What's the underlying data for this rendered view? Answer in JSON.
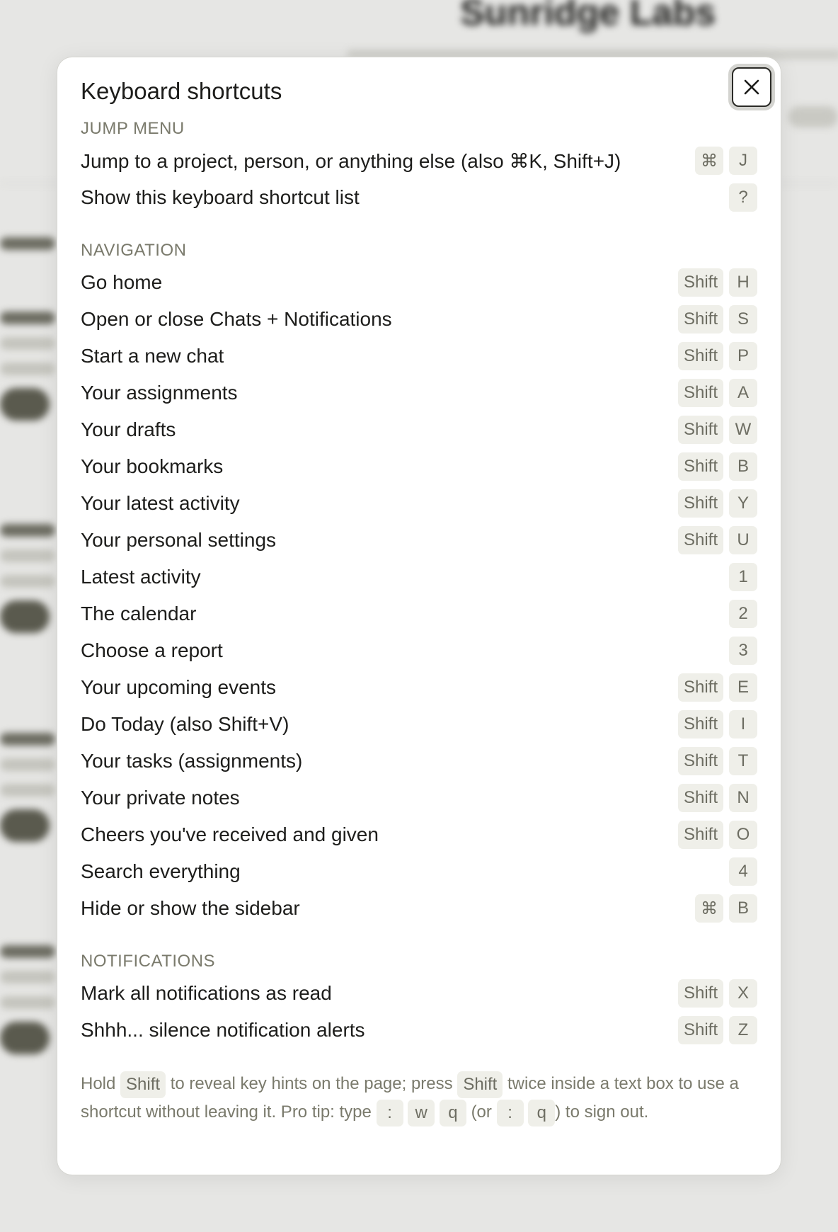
{
  "background": {
    "title": "Sunridge Labs"
  },
  "modal": {
    "title": "Keyboard shortcuts",
    "close_label": "×",
    "sections": [
      {
        "heading": "JUMP MENU",
        "rows": [
          {
            "label": "Jump to a project, person, or anything else (also ⌘K, Shift+J)",
            "keys": [
              "⌘",
              "J"
            ]
          },
          {
            "label": "Show this keyboard shortcut list",
            "keys": [
              "?"
            ]
          }
        ]
      },
      {
        "heading": "NAVIGATION",
        "rows": [
          {
            "label": "Go home",
            "keys": [
              "Shift",
              "H"
            ]
          },
          {
            "label": "Open or close Chats + Notifications",
            "keys": [
              "Shift",
              "S"
            ]
          },
          {
            "label": "Start a new chat",
            "keys": [
              "Shift",
              "P"
            ]
          },
          {
            "label": "Your assignments",
            "keys": [
              "Shift",
              "A"
            ]
          },
          {
            "label": "Your drafts",
            "keys": [
              "Shift",
              "W"
            ]
          },
          {
            "label": "Your bookmarks",
            "keys": [
              "Shift",
              "B"
            ]
          },
          {
            "label": "Your latest activity",
            "keys": [
              "Shift",
              "Y"
            ]
          },
          {
            "label": "Your personal settings",
            "keys": [
              "Shift",
              "U"
            ]
          },
          {
            "label": "Latest activity",
            "keys": [
              "1"
            ]
          },
          {
            "label": "The calendar",
            "keys": [
              "2"
            ]
          },
          {
            "label": "Choose a report",
            "keys": [
              "3"
            ]
          },
          {
            "label": "Your upcoming events",
            "keys": [
              "Shift",
              "E"
            ]
          },
          {
            "label": "Do Today (also Shift+V)",
            "keys": [
              "Shift",
              "I"
            ]
          },
          {
            "label": "Your tasks (assignments)",
            "keys": [
              "Shift",
              "T"
            ]
          },
          {
            "label": "Your private notes",
            "keys": [
              "Shift",
              "N"
            ]
          },
          {
            "label": "Cheers you've received and given",
            "keys": [
              "Shift",
              "O"
            ]
          },
          {
            "label": "Search everything",
            "keys": [
              "4"
            ]
          },
          {
            "label": "Hide or show the sidebar",
            "keys": [
              "⌘",
              "B"
            ]
          }
        ]
      },
      {
        "heading": "NOTIFICATIONS",
        "rows": [
          {
            "label": "Mark all notifications as read",
            "keys": [
              "Shift",
              "X"
            ]
          },
          {
            "label": "Shhh... silence notification alerts",
            "keys": [
              "Shift",
              "Z"
            ]
          }
        ]
      }
    ],
    "footnote": {
      "t1": "Hold",
      "k1": "Shift",
      "t2": "to reveal key hints on the page; press",
      "k2": "Shift",
      "t3": "twice inside a text box to use a shortcut without leaving it. Pro tip: type",
      "k3": ":",
      "k4": "w",
      "k5": "q",
      "t4": "(or",
      "k6": ":",
      "k7": "q",
      "t5": ") to sign out."
    }
  }
}
